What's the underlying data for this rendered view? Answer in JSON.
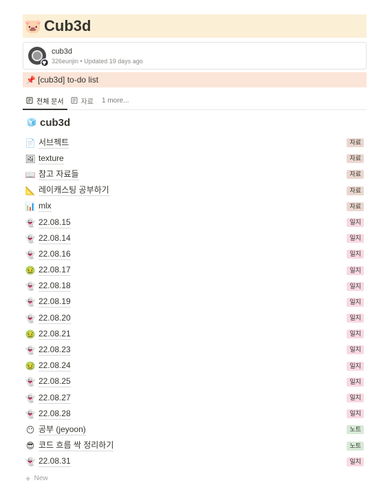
{
  "page": {
    "icon": "pig-face-icon",
    "icon_glyph": "🐷",
    "title": "Cub3d"
  },
  "bookmark": {
    "name": "cub3d",
    "meta": "326eunjin • Updated 19 days ago",
    "badge_icon": "github-icon"
  },
  "callout": {
    "icon": "pushpin-icon",
    "icon_glyph": "📌",
    "text": "[cub3d] to-do list"
  },
  "tabs": [
    {
      "label": "전체 문서",
      "icon": "document-icon",
      "active": true
    },
    {
      "label": "자료",
      "icon": "document-icon",
      "active": false
    },
    {
      "label": "1 more...",
      "icon": "",
      "active": false
    }
  ],
  "database": {
    "icon": "ice-cube-icon",
    "icon_glyph": "🧊",
    "title": "cub3d"
  },
  "rows": [
    {
      "icon": "page-icon",
      "glyph": "📄",
      "name": "서브젝트",
      "tag": "자료",
      "tag_type": "jaryo"
    },
    {
      "icon": "image-icon",
      "glyph": "🖼",
      "name": "texture",
      "tag": "자료",
      "tag_type": "jaryo"
    },
    {
      "icon": "open-book-icon",
      "glyph": "📖",
      "name": "참고 자료들",
      "tag": "자료",
      "tag_type": "jaryo"
    },
    {
      "icon": "triangle-ruler-icon",
      "glyph": "📐",
      "name": "레이캐스팅 공부하기",
      "tag": "자료",
      "tag_type": "jaryo"
    },
    {
      "icon": "bar-chart-icon",
      "glyph": "📊",
      "name": "mlx",
      "tag": "자료",
      "tag_type": "jaryo"
    },
    {
      "icon": "ghost-icon",
      "glyph": "👻",
      "name": "22.08.15",
      "tag": "일지",
      "tag_type": "ilji"
    },
    {
      "icon": "ghost-icon",
      "glyph": "👻",
      "name": "22.08.14",
      "tag": "일지",
      "tag_type": "ilji"
    },
    {
      "icon": "ghost-icon",
      "glyph": "👻",
      "name": "22.08.16",
      "tag": "일지",
      "tag_type": "ilji"
    },
    {
      "icon": "nauseated-face-icon",
      "glyph": "🤢",
      "name": "22.08.17",
      "tag": "일지",
      "tag_type": "ilji"
    },
    {
      "icon": "ghost-icon",
      "glyph": "👻",
      "name": "22.08.18",
      "tag": "일지",
      "tag_type": "ilji"
    },
    {
      "icon": "ghost-icon",
      "glyph": "👻",
      "name": "22.08.19",
      "tag": "일지",
      "tag_type": "ilji"
    },
    {
      "icon": "ghost-icon",
      "glyph": "👻",
      "name": "22.08.20",
      "tag": "일지",
      "tag_type": "ilji"
    },
    {
      "icon": "nauseated-face-icon",
      "glyph": "🤢",
      "name": "22.08.21",
      "tag": "일지",
      "tag_type": "ilji"
    },
    {
      "icon": "ghost-icon",
      "glyph": "👻",
      "name": "22.08.23",
      "tag": "일지",
      "tag_type": "ilji"
    },
    {
      "icon": "nauseated-face-icon",
      "glyph": "🤢",
      "name": "22.08.24",
      "tag": "일지",
      "tag_type": "ilji"
    },
    {
      "icon": "ghost-icon",
      "glyph": "👻",
      "name": "22.08.25",
      "tag": "일지",
      "tag_type": "ilji"
    },
    {
      "icon": "ghost-icon",
      "glyph": "👻",
      "name": "22.08.27",
      "tag": "일지",
      "tag_type": "ilji"
    },
    {
      "icon": "ghost-icon",
      "glyph": "👻",
      "name": "22.08.28",
      "tag": "일지",
      "tag_type": "ilji"
    },
    {
      "icon": "face-without-mouth-icon",
      "glyph": "😶",
      "name": "공부 (jeyoon)",
      "tag": "노트",
      "tag_type": "note"
    },
    {
      "icon": "sunglasses-face-icon",
      "glyph": "😎",
      "name": "코드 흐름 싹 정리하기",
      "tag": "노트",
      "tag_type": "note"
    },
    {
      "icon": "ghost-icon",
      "glyph": "👻",
      "name": "22.08.31",
      "tag": "일지",
      "tag_type": "ilji"
    }
  ],
  "new_row": {
    "plus": "+",
    "label": "New"
  }
}
